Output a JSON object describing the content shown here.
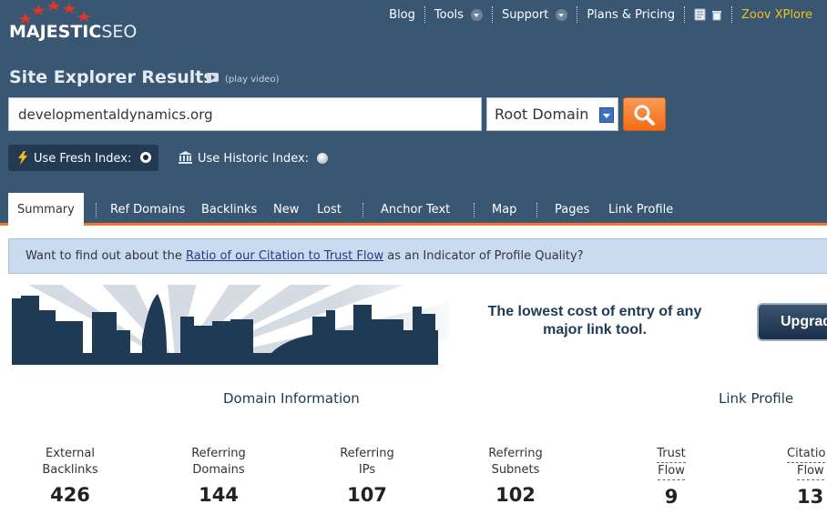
{
  "brand": {
    "logo_bold": "MAJESTIC",
    "logo_light": "SEO"
  },
  "topnav": {
    "items": [
      {
        "label": "Blog"
      },
      {
        "label": "Tools"
      },
      {
        "label": "Support"
      },
      {
        "label": "Plans & Pricing"
      }
    ],
    "icons": [
      "document-icon",
      "trash-icon"
    ],
    "user": "Zoov XPlore"
  },
  "page": {
    "title": "Site Explorer Results",
    "play_video": "(play video)"
  },
  "search": {
    "value": "developmentaldynamics.org",
    "scope": "Root Domain"
  },
  "index": {
    "fresh_label": "Use Fresh Index:",
    "historic_label": "Use Historic Index:",
    "selected": "fresh"
  },
  "tabs": [
    {
      "label": "Summary",
      "active": true
    },
    {
      "label": "Ref Domains"
    },
    {
      "label": "Backlinks"
    },
    {
      "label": "New"
    },
    {
      "label": "Lost"
    },
    {
      "label": "Anchor Text"
    },
    {
      "label": "Map"
    },
    {
      "label": "Pages"
    },
    {
      "label": "Link Profile"
    }
  ],
  "info": {
    "before": "Want to find out about the ",
    "link": "Ratio of our Citation to Trust Flow",
    "after": " as an Indicator of Profile Quality?"
  },
  "banner": {
    "line1": "The lowest cost of entry of any",
    "line2": "major link tool.",
    "button": "Upgrad"
  },
  "sections": {
    "domain": "Domain Information",
    "link": "Link Profile"
  },
  "metrics": [
    {
      "line1": "External",
      "line2": "Backlinks",
      "value": "426"
    },
    {
      "line1": "Referring",
      "line2": "Domains",
      "value": "144"
    },
    {
      "line1": "Referring",
      "line2": "IPs",
      "value": "107"
    },
    {
      "line1": "Referring",
      "line2": "Subnets",
      "value": "102"
    },
    {
      "line1": "Trust",
      "line2": "Flow",
      "value": "9"
    },
    {
      "line1": "Citatio",
      "line2": "Flow",
      "value": "13"
    }
  ],
  "colors": {
    "header": "#395672",
    "accent": "#f07a27",
    "user_link": "#f2c01d"
  }
}
